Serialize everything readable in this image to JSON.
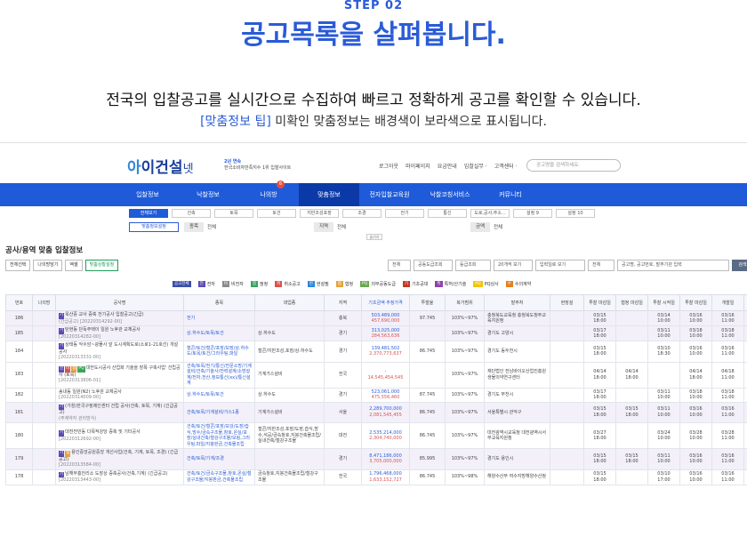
{
  "step": "STEP 02",
  "headline": "공고목록을 살펴봅니다.",
  "desc1": "전국의 입찰공고를 실시간으로 수집하여 빠르고 정확하게 공고를 확인할 수 있습니다.",
  "desc2_tip": "[맞춤정보 팁]",
  "desc2_text": " 미확인 맞춤정보는 배경색이 보라색으로 표시됩니다.",
  "logo": {
    "prefix": "아",
    "rest": "이건설",
    "tail": "넷",
    "sub1": "2년 연속",
    "sub2": "한국소비자만족지수 1위 입찰사이트"
  },
  "toplinks": [
    "로그아웃",
    "마이페이지",
    "요금안내",
    "입찰실무 ·",
    "고객센터 ·"
  ],
  "topsearch_placeholder": "공고명을 검색하세요.",
  "nav": [
    {
      "label": "입찰정보"
    },
    {
      "label": "낙찰정보"
    },
    {
      "label": "나의방",
      "badge": "6"
    },
    {
      "label": "맞춤정보",
      "active": true
    },
    {
      "label": "전자입찰교육원"
    },
    {
      "label": "낙찰코칭서비스"
    },
    {
      "label": "커뮤니티"
    }
  ],
  "subtabs": [
    {
      "label": "전체보기",
      "on": true
    },
    {
      "label": "건축"
    },
    {
      "label": "토목"
    },
    {
      "label": "토건"
    },
    {
      "label": "지반조성포장"
    },
    {
      "label": "조경"
    },
    {
      "label": "전기"
    },
    {
      "label": "통신"
    },
    {
      "label": "도로,공사,주소..."
    },
    {
      "label": "설정 9"
    },
    {
      "label": "설정 10"
    }
  ],
  "filter": {
    "button": "맞춤정보설정",
    "k1": "종목",
    "v1": "전체",
    "k2": "지역",
    "v2": "전체",
    "k3": "금액",
    "v3": "전체"
  },
  "more": "숨기기",
  "section_title": "공사/용역 맞춤 입찰정보",
  "tools": [
    "전체선택",
    "나의방담기",
    "엑셀",
    "맞춤상황설정"
  ],
  "selects": [
    "전체",
    "공동도급조회",
    "등급조회",
    "20개씩 보기",
    "입력일로 보기",
    "전체",
    "공고명, 공고번호, 발주기관 입력"
  ],
  "search_btn": "검색",
  "legend": [
    {
      "tag": "공고전체",
      "color": "#3b4ea8"
    },
    {
      "tag": "전",
      "text": "전자",
      "color": "#5b4bb7"
    },
    {
      "tag": "비",
      "text": "비전자",
      "color": "#8a8a8a"
    },
    {
      "tag": "정",
      "text": "정정",
      "color": "#3aa45b"
    },
    {
      "tag": "취",
      "text": "취소공고",
      "color": "#d9534f"
    },
    {
      "tag": "현",
      "text": "현설필",
      "color": "#2e86de"
    },
    {
      "tag": "협",
      "text": "협정",
      "color": "#e6a23c"
    },
    {
      "tag": "PQ",
      "text": "의무공동도급",
      "color": "#6aa84f"
    },
    {
      "tag": "기",
      "text": "기초공대",
      "color": "#c0392b"
    },
    {
      "tag": "특",
      "text": "특허/산기술",
      "color": "#8e44ad"
    },
    {
      "tag": "PQ",
      "text": "PQ심사",
      "color": "#f1c40f"
    },
    {
      "tag": "수",
      "text": "수의계약",
      "color": "#e67e22"
    }
  ],
  "columns": [
    "번호",
    "나의방",
    "공사명",
    "종목",
    "대업종",
    "지역",
    "기초금액 추정가격",
    "투찰율",
    "복가범위",
    "발주처",
    "현장설",
    "투찰 마감일",
    "협정 마감일",
    "투찰 시작일",
    "투찰 마감일",
    "개찰일",
    "입력일"
  ],
  "rows": [
    {
      "no": "186",
      "u": true,
      "tags": [
        "기"
      ],
      "name": "옥산중 교사 증축 전기공사 입찰공고(긴급)",
      "code": "(간급공고) [20220314292-00]",
      "item": "전기",
      "main": "",
      "region": "충북",
      "a1": "503,489,000",
      "a2": "457,690,000",
      "rate": "97.745",
      "range": "103%~97%",
      "org": "충청북도교육청 충청북도청주교육지원청",
      "site": "",
      "d1": "03/15 18:00",
      "d2": "",
      "d3": "03/14 10:00",
      "d4": "03/16 10:00",
      "d5": "03/16 11:00",
      "d6": "03/10"
    },
    {
      "no": "185",
      "u": true,
      "tags": [
        "기"
      ],
      "name": "탄현동 단독주택이 일원 노후관 교체공사",
      "code": "[20220314282-00]",
      "item": "상.하수도/토목/토건",
      "main": "상.하수도",
      "region": "경기",
      "a1": "313,025,000",
      "a2": "284,563,636",
      "rate": "",
      "range": "103%~97%",
      "org": "경기도 고양시",
      "site": "",
      "d1": "03/17 18:00",
      "d2": "",
      "d3": "03/11 10:00",
      "d4": "03/18 10:00",
      "d5": "03/18 11:00",
      "d6": "03/10"
    },
    {
      "no": "184",
      "u": false,
      "tags": [
        "기"
      ],
      "name": "상태동 악수암~광물사 앞 도시계획도로(소로1-21호선) 개설공사",
      "code": "[20220313331-00]",
      "item": "철콘/토건/철콘/포장/보장/상.하수도/토목/토건/그라우팅,파일",
      "main": "철콘/지반조성,포장/상.하수도",
      "region": "경기",
      "a1": "139,481,502",
      "a2": "2,370,773,637",
      "rate": "86.745",
      "range": "103%~97%",
      "org": "경기도 동두천시",
      "site": "",
      "d1": "03/15 18:00",
      "d2": "",
      "d3": "03/10 18:30",
      "d4": "03/16 10:00",
      "d5": "03/16 11:00",
      "d6": "03/10"
    },
    {
      "no": "183",
      "u": false,
      "tags": [
        "전",
        "비",
        "협",
        "PQ"
      ],
      "name": "대전도시공사 산업화 기술을 장폭 구축사업' 건립공사 (토목)",
      "code": "[20220313806-01]",
      "item": "건축/토목/전기/통신/전문소방/기계설비/건축/기술사/전력설계/소방설계/전자,전산,정보통신(xx)/통신설계",
      "main": "기계가스설비",
      "region": "전국",
      "a1": "-",
      "a2": "14,545,454,545",
      "rate": "",
      "range": "103%~97%",
      "org": "재단법인 전남바이오산업진흥원 생물의약연구센터",
      "site": "",
      "d1": "04/14 18:00",
      "d2": "04/14 18:00",
      "d3": "",
      "d4": "04/14 18:00",
      "d5": "04/18 11:00",
      "d6": "03/10"
    },
    {
      "no": "182",
      "u": false,
      "tags": [],
      "name": "송내동 일원(N2) 노후관 교체공사",
      "code": "[20220314009-00]",
      "item": "상.하수도/토목/토건",
      "main": "상.하수도",
      "region": "경기",
      "a1": "523,061,000",
      "a2": "475,556,460",
      "rate": "87.745",
      "range": "103%~97%",
      "org": "경기도 부천시",
      "site": "",
      "d1": "03/17 18:00",
      "d2": "",
      "d3": "03/11 10:00",
      "d4": "03/18 10:00",
      "d5": "03/18 11:00",
      "d6": "03/10"
    },
    {
      "no": "181",
      "u": true,
      "tags": [
        "기"
      ],
      "name": "(가칭)한국구정례인센터 건립 공사(건축, 토목, 기계) (긴급공고)",
      "code": "(주계약자 관리방식)",
      "item": "건축/토목/기계설비/가스1종",
      "main": "기계가스설비",
      "region": "서울",
      "a1": "2,289,700,000",
      "a2": "2,081,545,455",
      "rate": "86.745",
      "range": "103%~97%",
      "org": "서울특별시 관악구",
      "site": "",
      "d1": "03/15 18:00",
      "d2": "03/15 18:00",
      "d3": "03/11 10:00",
      "d4": "03/16 10:00",
      "d5": "03/16 11:00",
      "d6": "03/10"
    },
    {
      "no": "180",
      "u": false,
      "tags": [
        "기"
      ],
      "name": "대전전민동 다목적강당 증축 및 기타공사",
      "code": "[20220312692-00]",
      "item": "건축/토건/철콘/포장/보강/도장/습식,방수/금속구조물,창호,온실/포장/실내건축/철강구조물/보링,그라우팅,파일/지붕판금,건축물조립",
      "main": "철콘/지반조성,포장/도장,습식,방수,석공/금속창호,지붕건축물조립/실내건축/철강구조물",
      "region": "대전",
      "a1": "2,535,214,000",
      "a2": "2,304,740,000",
      "rate": "86.745",
      "range": "103%~97%",
      "org": "대전광역시교육청 대전광역시서부교육지원청",
      "site": "",
      "d1": "03/27 18:00",
      "d2": "",
      "d3": "03/24 10:00",
      "d4": "03/28 10:00",
      "d5": "03/28 11:00",
      "d6": "03/10"
    },
    {
      "no": "179",
      "u": true,
      "tags": [
        "기",
        "협"
      ],
      "name": "용인중앙공원중앙 개선사업(건축, 기계, 토목, 조경) (긴급공고)",
      "code": "[20220313584-00]",
      "item": "건축/토목/기계/조경",
      "main": "",
      "region": "경기",
      "a1": "8,471,186,000",
      "a2": "3,705,000,000",
      "rate": "85.995",
      "range": "103%~97%",
      "org": "경기도 용인시",
      "site": "",
      "d1": "03/15 18:00",
      "d2": "03/15 18:00",
      "d3": "03/11 10:00",
      "d4": "03/16 10:00",
      "d5": "03/16 11:00",
      "d6": "03/10"
    },
    {
      "no": "178",
      "u": false,
      "tags": [
        "기"
      ],
      "name": "남해부흥전리소 도장상 증축공사(건축,기계) (긴급공고)",
      "code": "[20220313443-00]",
      "item": "건축/토건/금속구조물,창호,온실/철강구조물/지붕판금,건축물조립",
      "main": "금속창호,지붕건축물조립/철강구조물",
      "region": "전국",
      "a1": "1,796,468,000",
      "a2": "1,633,152,727",
      "rate": "86.745",
      "range": "103%~98%",
      "org": "해양수산부 여수지방해양수산청",
      "site": "",
      "d1": "03/15 18:00",
      "d2": "",
      "d3": "03/10 17:00",
      "d4": "03/16 10:00",
      "d5": "03/16 11:00",
      "d6": "03/10"
    }
  ]
}
